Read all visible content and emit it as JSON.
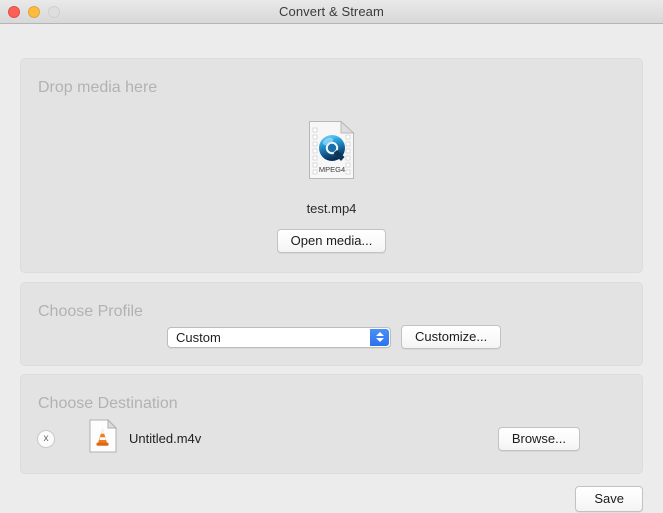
{
  "window": {
    "title": "Convert & Stream",
    "traffic_lights": [
      {
        "name": "close",
        "color": "#fc6059"
      },
      {
        "name": "minimize",
        "color": "#fdbc40"
      },
      {
        "name": "zoom",
        "color": "#dedede"
      }
    ]
  },
  "drop_media": {
    "heading": "Drop media here",
    "file_icon": "mpeg4-document-icon",
    "file_icon_label": "MPEG4",
    "filename": "test.mp4",
    "open_button": "Open media..."
  },
  "profile": {
    "heading": "Choose Profile",
    "selected": "Custom",
    "options": [
      "Custom"
    ],
    "popup_arrow_icon": "chevron-up-down-icon",
    "popup_accent_color": "#2b72ef",
    "customize_button": "Customize..."
  },
  "destination": {
    "heading": "Choose Destination",
    "remove_icon": "x",
    "file_icon": "vlc-cone-document-icon",
    "filename": "Untitled.m4v",
    "browse_button": "Browse..."
  },
  "footer": {
    "save_button": "Save"
  }
}
